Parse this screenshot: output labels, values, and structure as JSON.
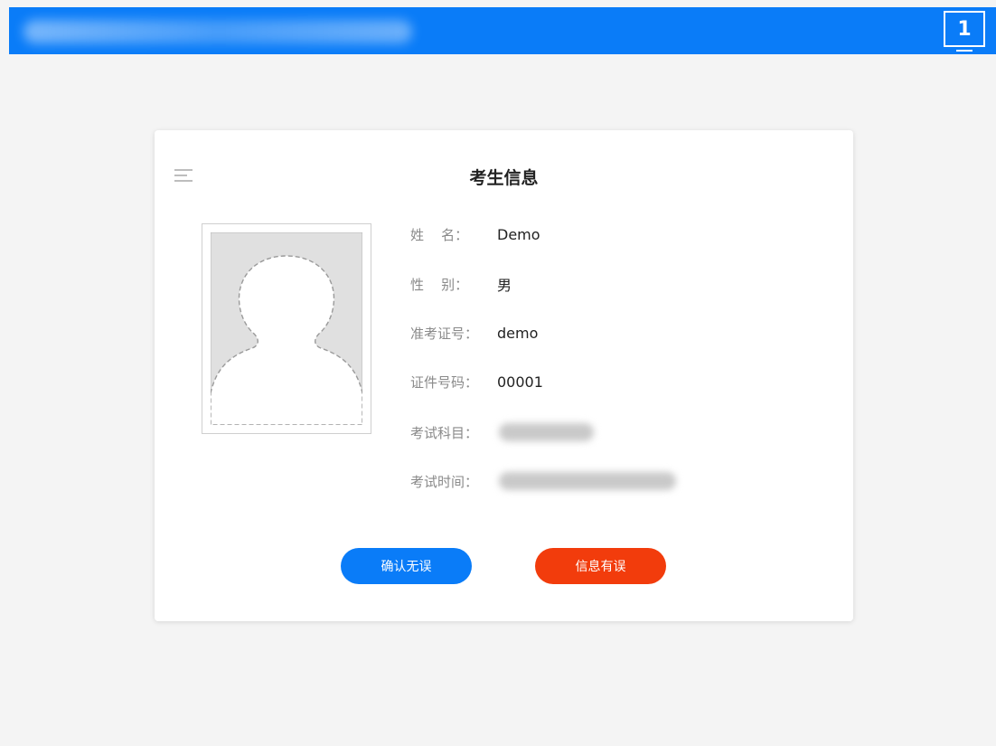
{
  "header": {
    "screen_number": "1",
    "colors": {
      "bar": "#0a7cf8"
    }
  },
  "card": {
    "title": "考生信息",
    "menu_icon": "hamburger-icon",
    "photo_icon": "avatar-placeholder-icon",
    "fields": [
      {
        "label": "姓    名：",
        "value": "Demo"
      },
      {
        "label": "性    别：",
        "value": "男"
      },
      {
        "label": "准考证号：",
        "value": "demo"
      },
      {
        "label": "证件号码：",
        "value": "00001"
      },
      {
        "label": "考试科目：",
        "value": ""
      },
      {
        "label": "考试时间：",
        "value": ""
      }
    ],
    "buttons": {
      "confirm_label": "确认无误",
      "error_label": "信息有误"
    },
    "colors": {
      "confirm": "#0a7cf8",
      "error": "#f23c0c"
    }
  }
}
